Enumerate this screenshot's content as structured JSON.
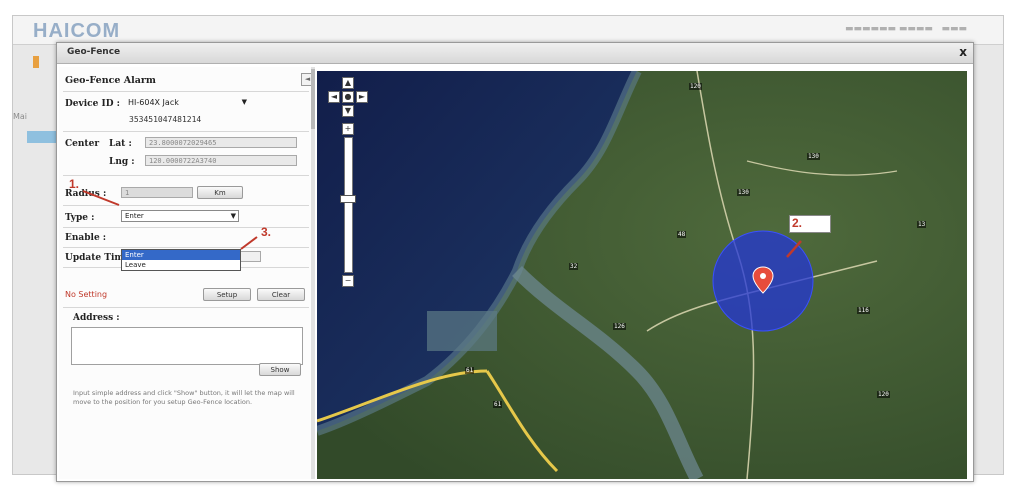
{
  "background_app": {
    "brand": "HAICOM",
    "nav_text": "Mai"
  },
  "dialog": {
    "title": "Geo-Fence",
    "close_label": "x",
    "panel": {
      "title": "Geo-Fence Alarm",
      "collapse_label": "◄",
      "device_id_label": "Device ID :",
      "device_select_value": "HI-604X Jack",
      "device_imei": "353451047481214",
      "center_label": "Center",
      "lat_label": "Lat :",
      "lat_value": "23.8000072029465",
      "lng_label": "Lng :",
      "lng_value": "120.0000722A3740",
      "radius_label": "Radius :",
      "radius_value": "1",
      "radius_unit_button": "Km",
      "type_label": "Type :",
      "type_value": "Enter",
      "type_options": [
        "Enter",
        "Leave"
      ],
      "enable_label": "Enable :",
      "update_time_label": "Update Time :",
      "no_setting": "No Setting",
      "setup_button": "Setup",
      "clear_button": "Clear",
      "address_label": "Address :",
      "show_button": "Show",
      "help_text": "Input simple address and click \"Show\" button, it will let the map will move to the position for you setup Geo-Fence location."
    },
    "annotations": [
      "1.",
      "2.",
      "3."
    ],
    "map": {
      "zoom_plus": "+",
      "zoom_minus": "−",
      "road_labels": [
        "120",
        "130",
        "32",
        "126",
        "61",
        "116",
        "130",
        "48",
        "61",
        "120",
        "13"
      ]
    }
  },
  "colors": {
    "fence_circle": "#2336d6",
    "annotation_red": "#c0392b",
    "dropdown_selected": "#3469c8"
  }
}
